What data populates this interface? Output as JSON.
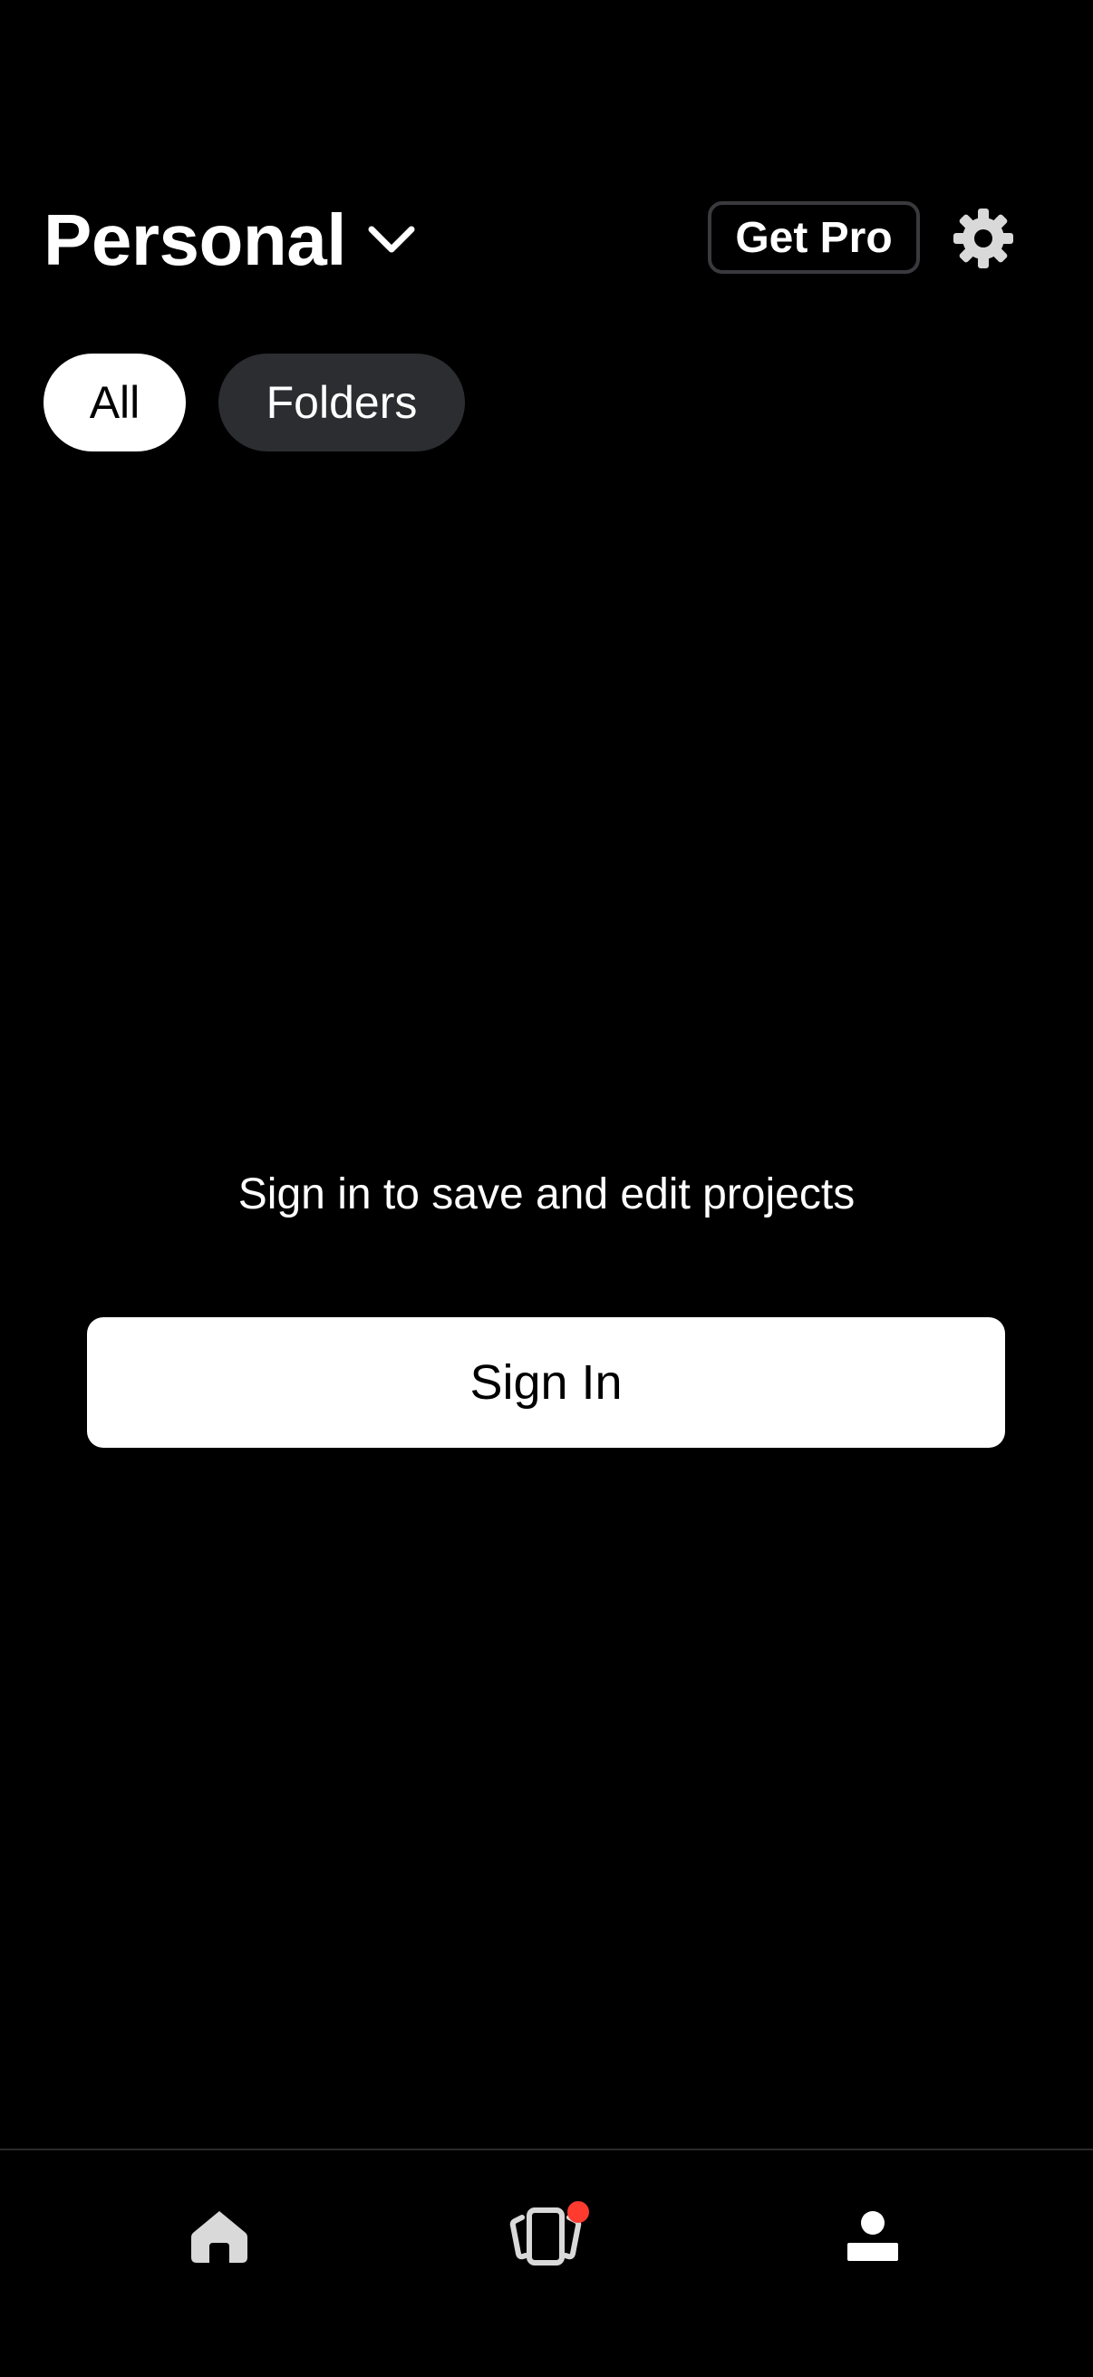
{
  "header": {
    "workspace_title": "Personal",
    "get_pro_label": "Get Pro"
  },
  "filters": {
    "chips": [
      {
        "label": "All",
        "selected": true
      },
      {
        "label": "Folders",
        "selected": false
      }
    ]
  },
  "empty_state": {
    "message": "Sign in to save and edit projects",
    "sign_in_label": "Sign In"
  },
  "tabbar": {
    "tabs": [
      {
        "icon": "home-icon",
        "selected": false
      },
      {
        "icon": "cards-icon",
        "selected": false,
        "badge": true
      },
      {
        "icon": "profile-icon",
        "selected": true
      }
    ]
  },
  "colors": {
    "background": "#000000",
    "chip_unselected": "#2b2d31",
    "badge": "#ff3b30",
    "inactive_icon": "#d9d9d9"
  }
}
